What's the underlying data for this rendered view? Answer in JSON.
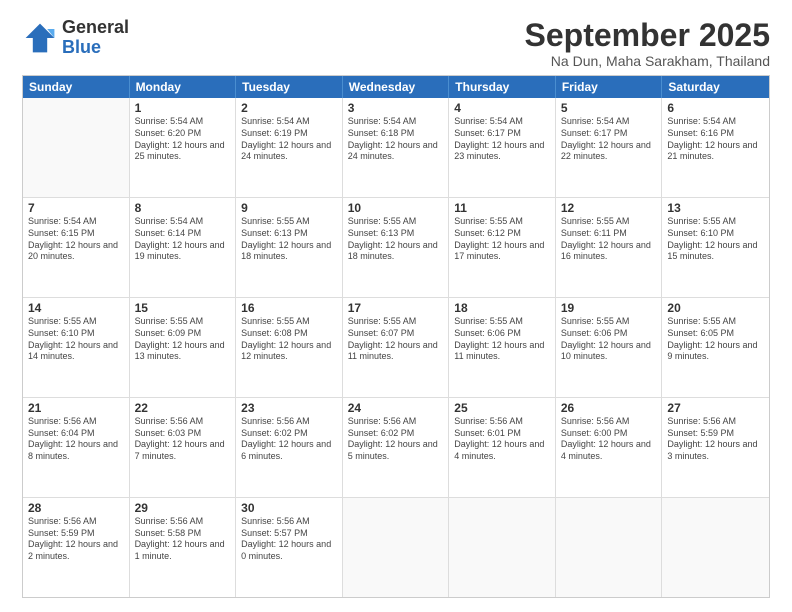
{
  "logo": {
    "general": "General",
    "blue": "Blue"
  },
  "title": "September 2025",
  "subtitle": "Na Dun, Maha Sarakham, Thailand",
  "weekdays": [
    "Sunday",
    "Monday",
    "Tuesday",
    "Wednesday",
    "Thursday",
    "Friday",
    "Saturday"
  ],
  "weeks": [
    [
      {
        "date": "",
        "sunrise": "",
        "sunset": "",
        "daylight": ""
      },
      {
        "date": "1",
        "sunrise": "Sunrise: 5:54 AM",
        "sunset": "Sunset: 6:20 PM",
        "daylight": "Daylight: 12 hours and 25 minutes."
      },
      {
        "date": "2",
        "sunrise": "Sunrise: 5:54 AM",
        "sunset": "Sunset: 6:19 PM",
        "daylight": "Daylight: 12 hours and 24 minutes."
      },
      {
        "date": "3",
        "sunrise": "Sunrise: 5:54 AM",
        "sunset": "Sunset: 6:18 PM",
        "daylight": "Daylight: 12 hours and 24 minutes."
      },
      {
        "date": "4",
        "sunrise": "Sunrise: 5:54 AM",
        "sunset": "Sunset: 6:17 PM",
        "daylight": "Daylight: 12 hours and 23 minutes."
      },
      {
        "date": "5",
        "sunrise": "Sunrise: 5:54 AM",
        "sunset": "Sunset: 6:17 PM",
        "daylight": "Daylight: 12 hours and 22 minutes."
      },
      {
        "date": "6",
        "sunrise": "Sunrise: 5:54 AM",
        "sunset": "Sunset: 6:16 PM",
        "daylight": "Daylight: 12 hours and 21 minutes."
      }
    ],
    [
      {
        "date": "7",
        "sunrise": "Sunrise: 5:54 AM",
        "sunset": "Sunset: 6:15 PM",
        "daylight": "Daylight: 12 hours and 20 minutes."
      },
      {
        "date": "8",
        "sunrise": "Sunrise: 5:54 AM",
        "sunset": "Sunset: 6:14 PM",
        "daylight": "Daylight: 12 hours and 19 minutes."
      },
      {
        "date": "9",
        "sunrise": "Sunrise: 5:55 AM",
        "sunset": "Sunset: 6:13 PM",
        "daylight": "Daylight: 12 hours and 18 minutes."
      },
      {
        "date": "10",
        "sunrise": "Sunrise: 5:55 AM",
        "sunset": "Sunset: 6:13 PM",
        "daylight": "Daylight: 12 hours and 18 minutes."
      },
      {
        "date": "11",
        "sunrise": "Sunrise: 5:55 AM",
        "sunset": "Sunset: 6:12 PM",
        "daylight": "Daylight: 12 hours and 17 minutes."
      },
      {
        "date": "12",
        "sunrise": "Sunrise: 5:55 AM",
        "sunset": "Sunset: 6:11 PM",
        "daylight": "Daylight: 12 hours and 16 minutes."
      },
      {
        "date": "13",
        "sunrise": "Sunrise: 5:55 AM",
        "sunset": "Sunset: 6:10 PM",
        "daylight": "Daylight: 12 hours and 15 minutes."
      }
    ],
    [
      {
        "date": "14",
        "sunrise": "Sunrise: 5:55 AM",
        "sunset": "Sunset: 6:10 PM",
        "daylight": "Daylight: 12 hours and 14 minutes."
      },
      {
        "date": "15",
        "sunrise": "Sunrise: 5:55 AM",
        "sunset": "Sunset: 6:09 PM",
        "daylight": "Daylight: 12 hours and 13 minutes."
      },
      {
        "date": "16",
        "sunrise": "Sunrise: 5:55 AM",
        "sunset": "Sunset: 6:08 PM",
        "daylight": "Daylight: 12 hours and 12 minutes."
      },
      {
        "date": "17",
        "sunrise": "Sunrise: 5:55 AM",
        "sunset": "Sunset: 6:07 PM",
        "daylight": "Daylight: 12 hours and 11 minutes."
      },
      {
        "date": "18",
        "sunrise": "Sunrise: 5:55 AM",
        "sunset": "Sunset: 6:06 PM",
        "daylight": "Daylight: 12 hours and 11 minutes."
      },
      {
        "date": "19",
        "sunrise": "Sunrise: 5:55 AM",
        "sunset": "Sunset: 6:06 PM",
        "daylight": "Daylight: 12 hours and 10 minutes."
      },
      {
        "date": "20",
        "sunrise": "Sunrise: 5:55 AM",
        "sunset": "Sunset: 6:05 PM",
        "daylight": "Daylight: 12 hours and 9 minutes."
      }
    ],
    [
      {
        "date": "21",
        "sunrise": "Sunrise: 5:56 AM",
        "sunset": "Sunset: 6:04 PM",
        "daylight": "Daylight: 12 hours and 8 minutes."
      },
      {
        "date": "22",
        "sunrise": "Sunrise: 5:56 AM",
        "sunset": "Sunset: 6:03 PM",
        "daylight": "Daylight: 12 hours and 7 minutes."
      },
      {
        "date": "23",
        "sunrise": "Sunrise: 5:56 AM",
        "sunset": "Sunset: 6:02 PM",
        "daylight": "Daylight: 12 hours and 6 minutes."
      },
      {
        "date": "24",
        "sunrise": "Sunrise: 5:56 AM",
        "sunset": "Sunset: 6:02 PM",
        "daylight": "Daylight: 12 hours and 5 minutes."
      },
      {
        "date": "25",
        "sunrise": "Sunrise: 5:56 AM",
        "sunset": "Sunset: 6:01 PM",
        "daylight": "Daylight: 12 hours and 4 minutes."
      },
      {
        "date": "26",
        "sunrise": "Sunrise: 5:56 AM",
        "sunset": "Sunset: 6:00 PM",
        "daylight": "Daylight: 12 hours and 4 minutes."
      },
      {
        "date": "27",
        "sunrise": "Sunrise: 5:56 AM",
        "sunset": "Sunset: 5:59 PM",
        "daylight": "Daylight: 12 hours and 3 minutes."
      }
    ],
    [
      {
        "date": "28",
        "sunrise": "Sunrise: 5:56 AM",
        "sunset": "Sunset: 5:59 PM",
        "daylight": "Daylight: 12 hours and 2 minutes."
      },
      {
        "date": "29",
        "sunrise": "Sunrise: 5:56 AM",
        "sunset": "Sunset: 5:58 PM",
        "daylight": "Daylight: 12 hours and 1 minute."
      },
      {
        "date": "30",
        "sunrise": "Sunrise: 5:56 AM",
        "sunset": "Sunset: 5:57 PM",
        "daylight": "Daylight: 12 hours and 0 minutes."
      },
      {
        "date": "",
        "sunrise": "",
        "sunset": "",
        "daylight": ""
      },
      {
        "date": "",
        "sunrise": "",
        "sunset": "",
        "daylight": ""
      },
      {
        "date": "",
        "sunrise": "",
        "sunset": "",
        "daylight": ""
      },
      {
        "date": "",
        "sunrise": "",
        "sunset": "",
        "daylight": ""
      }
    ]
  ]
}
